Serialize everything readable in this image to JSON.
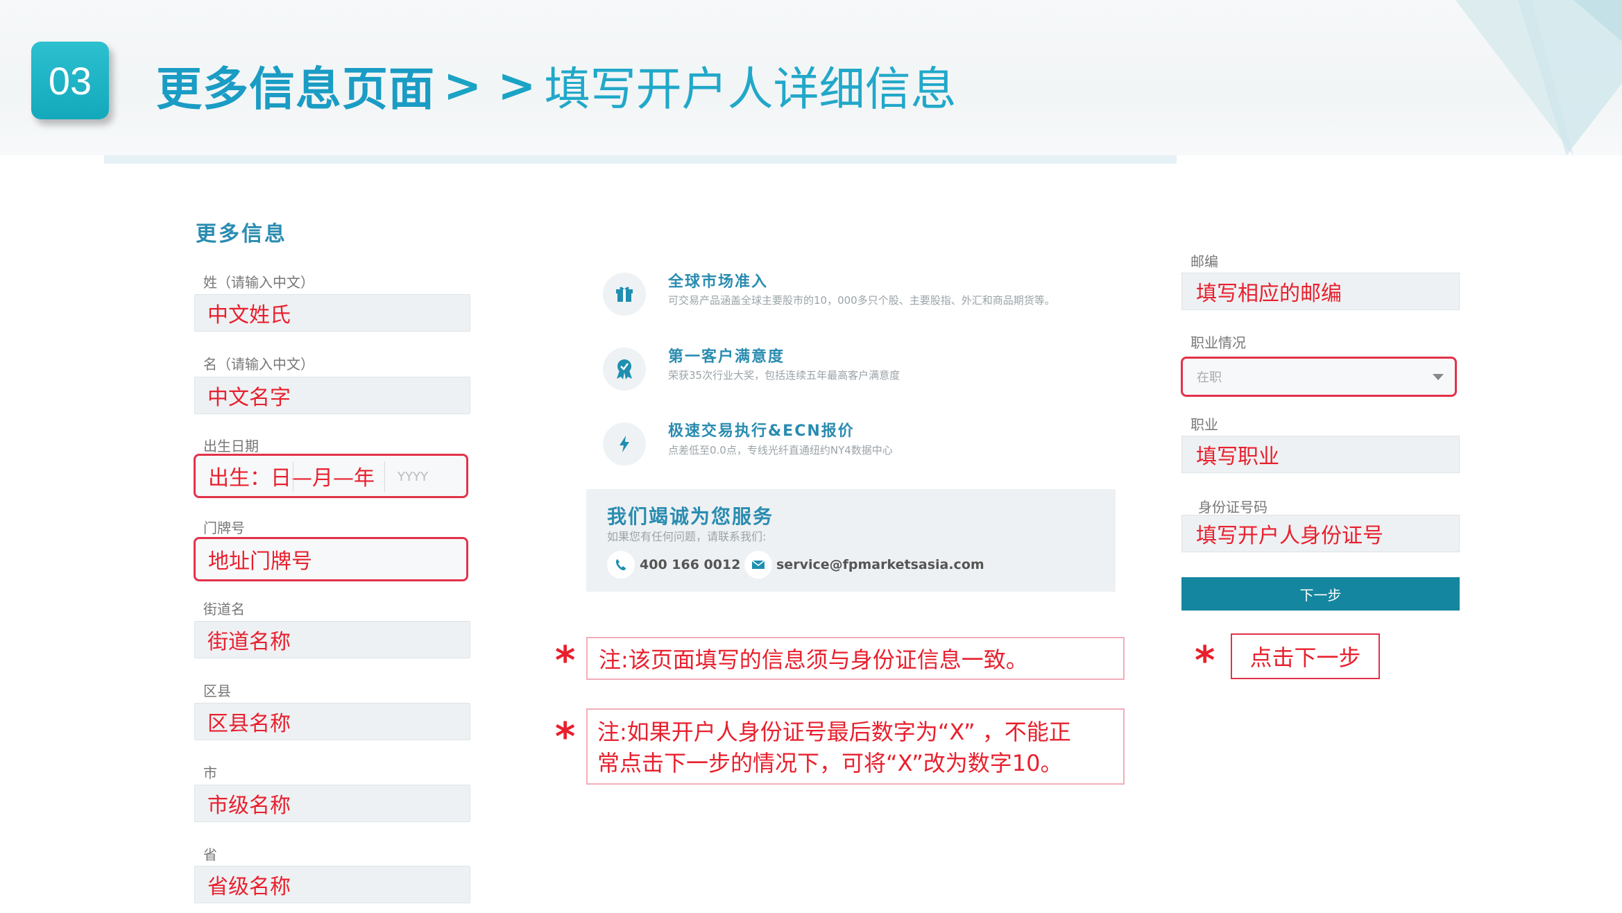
{
  "header": {
    "badge": "03",
    "title_main": "更多信息页面",
    "separator": "> >",
    "title_sub": "填写开户人详细信息"
  },
  "form": {
    "section_title": "更多信息",
    "fields": [
      {
        "label": "姓（请输入中文）",
        "value": "中文姓氏"
      },
      {
        "label": "名（请输入中文）",
        "value": "中文名字"
      },
      {
        "label": "出生日期",
        "value": "出生：日—月—年",
        "placeholder": "YYYY"
      },
      {
        "label": "门牌号",
        "value": "地址门牌号"
      },
      {
        "label": "街道名",
        "value": "街道名称"
      },
      {
        "label": "区县",
        "value": "区县名称"
      },
      {
        "label": "市",
        "value": "市级名称"
      },
      {
        "label": "省",
        "value": "省级名称"
      }
    ]
  },
  "features": [
    {
      "icon": "gift-box-icon",
      "title": "全球市场准入",
      "desc": "可交易产品涵盖全球主要股市的10，000多只个股、主要股指、外汇和商品期货等。"
    },
    {
      "icon": "award-ribbon-icon",
      "title": "第一客户满意度",
      "desc": "荣获35次行业大奖，包括连续五年最高客户满意度"
    },
    {
      "icon": "lightning-icon",
      "title": "极速交易执行&ECN报价",
      "desc": "点差低至0.0点，专线光纤直通纽约NY4数据中心"
    }
  ],
  "service": {
    "title": "我们竭诚为您服务",
    "subtitle": "如果您有任何问题，请联系我们:",
    "phone": "400 166 0012",
    "email": "service@fpmarketsasia.com"
  },
  "notes": [
    {
      "text": "注:该页面填写的信息须与身份证信息一致。"
    },
    {
      "line1": "注:如果开户人身份证号最后数字为“X” ，不能正",
      "line2": "常点击下一步的情况下，可将“X”改为数字10。"
    }
  ],
  "right_form": {
    "postcode": {
      "label": "邮编",
      "value": "填写相应的邮编"
    },
    "employment": {
      "label": "职业情况",
      "value": "在职"
    },
    "occupation": {
      "label": "职业",
      "value": "填写职业"
    },
    "id_number": {
      "label": "身份证号码",
      "value": "填写开户人身份证号"
    },
    "next_button": "下一步",
    "click_note": "点击下一步"
  },
  "colors": {
    "accent": "#1aa3c4",
    "highlight_red": "#e2324a",
    "button": "#14869f"
  }
}
